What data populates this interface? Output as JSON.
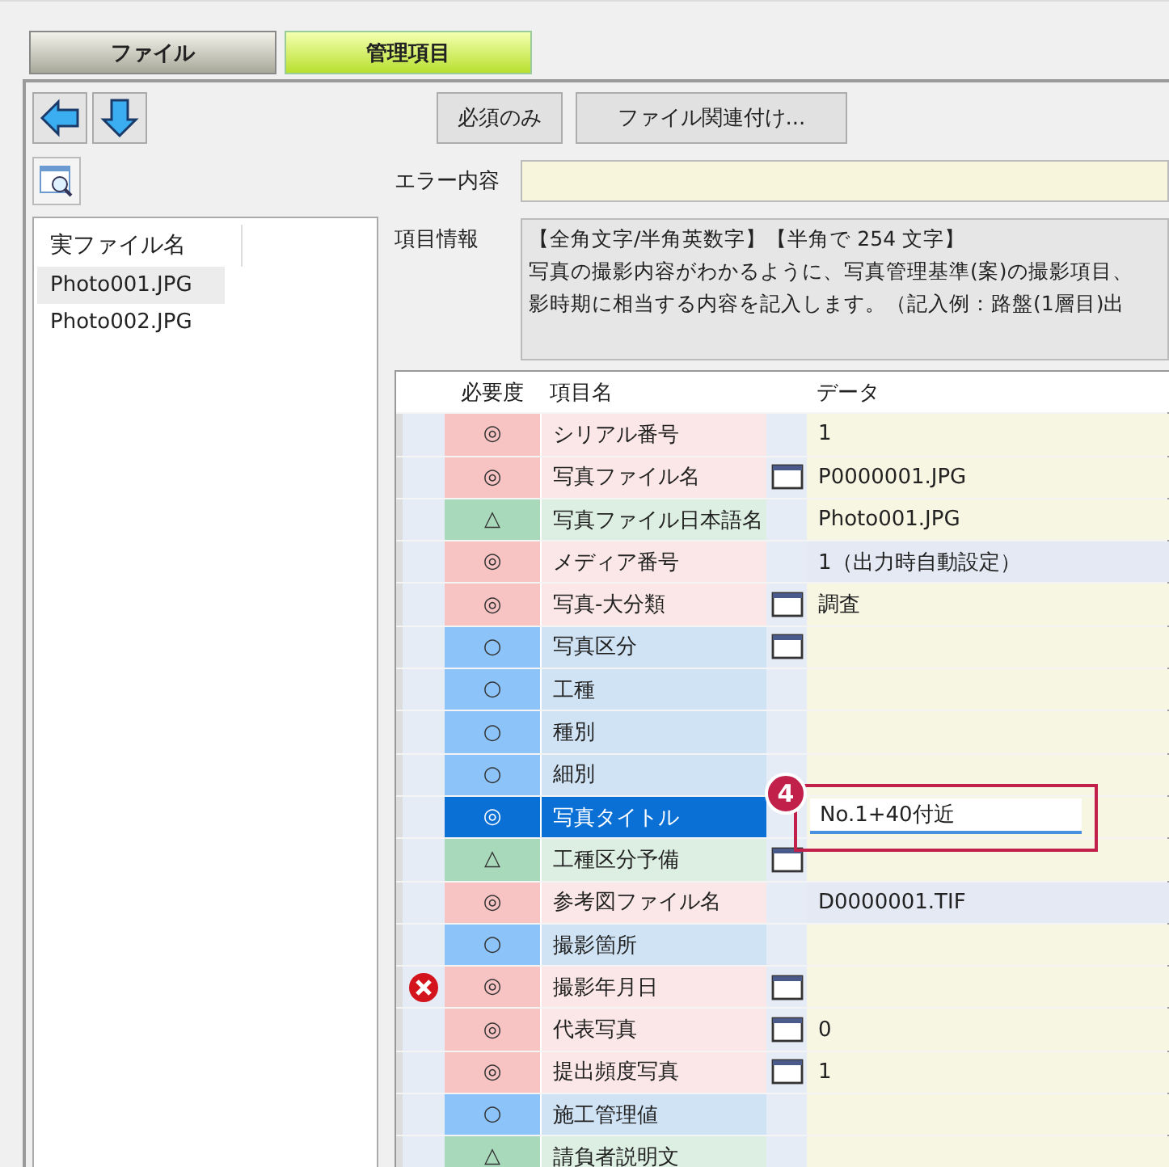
{
  "tabs": [
    {
      "label": "ファイル",
      "selected": false
    },
    {
      "label": "管理項目",
      "selected": true
    }
  ],
  "toolbar": {
    "buttons": [
      "必須のみ",
      "ファイル関連付け..."
    ]
  },
  "file_list": {
    "column": "実ファイル名",
    "items": [
      {
        "label": "Photo001.JPG",
        "selected": true
      },
      {
        "label": "Photo002.JPG",
        "selected": false
      }
    ]
  },
  "error_field": {
    "label": "エラー内容"
  },
  "item_info": {
    "label": "項目情報",
    "lines": [
      "【全角文字/半角英数字】【半角で 254 文字】",
      "写真の撮影内容がわかるように、写真管理基準(案)の撮影項目、",
      "影時期に相当する内容を記入します。（記入例：路盤(1層目)出"
    ]
  },
  "table": {
    "columns": [
      "必要度",
      "項目名",
      "データ"
    ],
    "rows": [
      {
        "kind": "required",
        "mark": "◎",
        "name": "シリアル番号",
        "picker": false,
        "value": "1",
        "readonly": false,
        "selected": false,
        "error": false
      },
      {
        "kind": "required",
        "mark": "◎",
        "name": "写真ファイル名",
        "picker": true,
        "value": "P0000001.JPG",
        "readonly": false,
        "selected": false,
        "error": false
      },
      {
        "kind": "optional",
        "mark": "△",
        "name": "写真ファイル日本語名",
        "picker": false,
        "value": "Photo001.JPG",
        "readonly": false,
        "selected": false,
        "error": false
      },
      {
        "kind": "required",
        "mark": "◎",
        "name": "メディア番号",
        "picker": false,
        "value": "1（出力時自動設定）",
        "readonly": true,
        "selected": false,
        "error": false
      },
      {
        "kind": "required",
        "mark": "◎",
        "name": "写真-大分類",
        "picker": true,
        "value": "調査",
        "readonly": false,
        "selected": false,
        "error": false
      },
      {
        "kind": "conditional",
        "mark": "○",
        "name": "写真区分",
        "picker": true,
        "value": "",
        "readonly": false,
        "selected": false,
        "error": false
      },
      {
        "kind": "conditional",
        "mark": "○",
        "name": "工種",
        "picker": false,
        "value": "",
        "readonly": false,
        "selected": false,
        "error": false
      },
      {
        "kind": "conditional",
        "mark": "○",
        "name": "種別",
        "picker": false,
        "value": "",
        "readonly": false,
        "selected": false,
        "error": false
      },
      {
        "kind": "conditional",
        "mark": "○",
        "name": "細別",
        "picker": false,
        "value": "",
        "readonly": false,
        "selected": false,
        "error": false
      },
      {
        "kind": "required",
        "mark": "◎",
        "name": "写真タイトル",
        "picker": false,
        "value": "No.1+40付近",
        "readonly": false,
        "selected": true,
        "error": false
      },
      {
        "kind": "optional",
        "mark": "△",
        "name": "工種区分予備",
        "picker": true,
        "value": "",
        "readonly": false,
        "selected": false,
        "error": false
      },
      {
        "kind": "required",
        "mark": "◎",
        "name": "参考図ファイル名",
        "picker": false,
        "value": "D0000001.TIF",
        "readonly": true,
        "selected": false,
        "error": false
      },
      {
        "kind": "conditional",
        "mark": "○",
        "name": "撮影箇所",
        "picker": false,
        "value": "",
        "readonly": false,
        "selected": false,
        "error": false
      },
      {
        "kind": "required",
        "mark": "◎",
        "name": "撮影年月日",
        "picker": true,
        "value": "",
        "readonly": false,
        "selected": false,
        "error": true
      },
      {
        "kind": "required",
        "mark": "◎",
        "name": "代表写真",
        "picker": true,
        "value": "0",
        "readonly": false,
        "selected": false,
        "error": false
      },
      {
        "kind": "required",
        "mark": "◎",
        "name": "提出頻度写真",
        "picker": true,
        "value": "1",
        "readonly": false,
        "selected": false,
        "error": false
      },
      {
        "kind": "conditional",
        "mark": "○",
        "name": "施工管理値",
        "picker": false,
        "value": "",
        "readonly": false,
        "selected": false,
        "error": false
      },
      {
        "kind": "optional",
        "mark": "△",
        "name": "請負者説明文",
        "picker": false,
        "value": "",
        "readonly": false,
        "selected": false,
        "error": false
      }
    ]
  },
  "callout": {
    "label": "4"
  }
}
